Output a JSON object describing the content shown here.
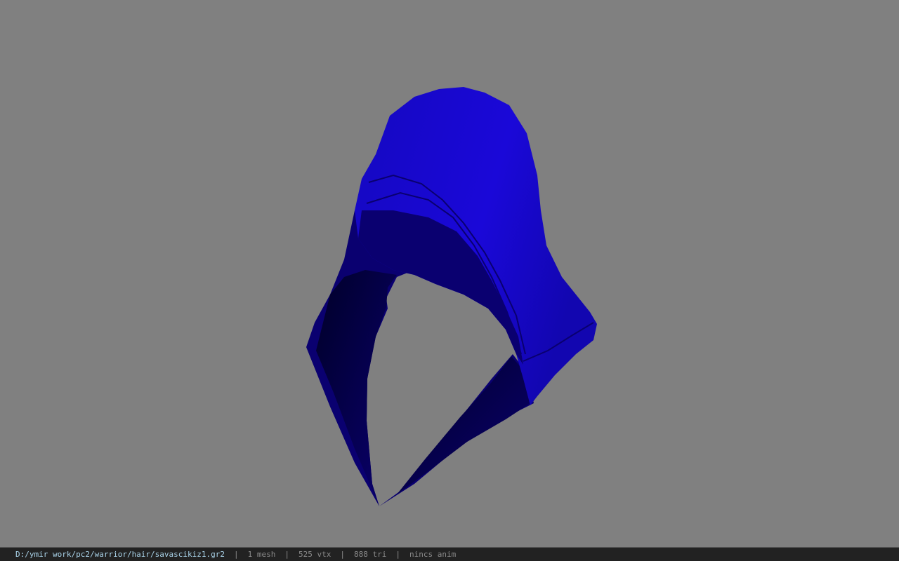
{
  "viewer": {
    "colors": {
      "viewport_background": "#808080",
      "statusbar_background": "#222222",
      "statusbar_text": "#8a8a8a",
      "path_text": "#a9d2e8",
      "model_main": "#1a08d8",
      "model_dark": "#0a0070",
      "model_inner": "#000028"
    }
  },
  "status_bar": {
    "file_path": "D:/ymir work/pc2/warrior/hair/savascikiz1.gr2",
    "separator": "|",
    "mesh_count": "1 mesh",
    "vertex_count": "525 vtx",
    "triangle_count": "888 tri",
    "animation_status": "nincs anim"
  }
}
